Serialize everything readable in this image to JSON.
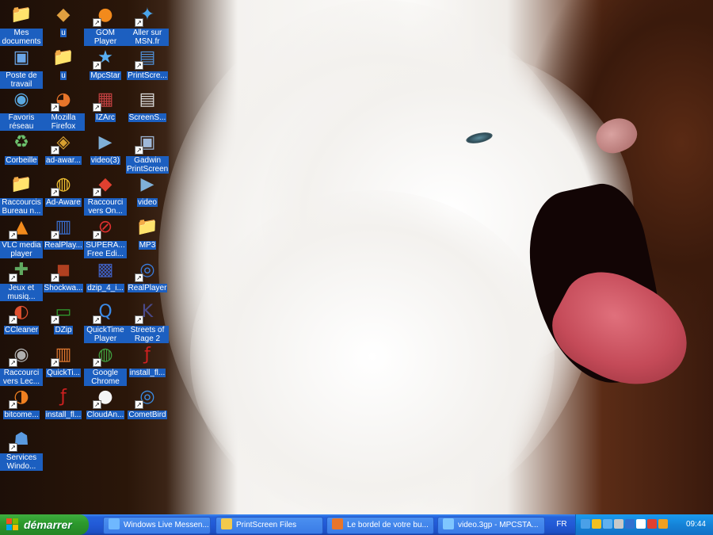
{
  "desktop_icons": [
    {
      "label": "Mes documents",
      "icon": "folder-documents-icon",
      "shortcut": false
    },
    {
      "label": "u",
      "icon": "app-icon",
      "shortcut": false
    },
    {
      "label": "GOM Player",
      "icon": "gom-player-icon",
      "shortcut": true
    },
    {
      "label": "Aller sur MSN.fr",
      "icon": "msn-icon",
      "shortcut": true
    },
    {
      "label": "Poste de travail",
      "icon": "computer-icon",
      "shortcut": false
    },
    {
      "label": "u",
      "icon": "folder-icon",
      "shortcut": false
    },
    {
      "label": "MpcStar",
      "icon": "mpcstar-icon",
      "shortcut": true
    },
    {
      "label": "PrintScre...",
      "icon": "printscreen-icon",
      "shortcut": true
    },
    {
      "label": "Favoris réseau",
      "icon": "network-icon",
      "shortcut": false
    },
    {
      "label": "Mozilla Firefox",
      "icon": "firefox-icon",
      "shortcut": true
    },
    {
      "label": "IZArc",
      "icon": "izarc-icon",
      "shortcut": true
    },
    {
      "label": "ScreenS...",
      "icon": "screenshot-file-icon",
      "shortcut": false
    },
    {
      "label": "Corbeille",
      "icon": "recycle-bin-icon",
      "shortcut": false
    },
    {
      "label": "ad-awar...",
      "icon": "adaware-icon",
      "shortcut": true
    },
    {
      "label": "video(3)",
      "icon": "video-file-icon",
      "shortcut": false
    },
    {
      "label": "Gadwin PrintScreen",
      "icon": "gadwin-icon",
      "shortcut": true
    },
    {
      "label": "Raccourcis Bureau n...",
      "icon": "folder-icon",
      "shortcut": false
    },
    {
      "label": "Ad-Aware",
      "icon": "adaware-globe-icon",
      "shortcut": true
    },
    {
      "label": "Raccourci vers On...",
      "icon": "shortcut-app-icon",
      "shortcut": true
    },
    {
      "label": "video",
      "icon": "video-file-icon",
      "shortcut": false
    },
    {
      "label": "VLC media player",
      "icon": "vlc-icon",
      "shortcut": true
    },
    {
      "label": "RealPlay...",
      "icon": "realplayer-box-icon",
      "shortcut": true
    },
    {
      "label": "SUPERA... Free Edi...",
      "icon": "supera-icon",
      "shortcut": true
    },
    {
      "label": "MP3",
      "icon": "folder-icon",
      "shortcut": false
    },
    {
      "label": "Jeux et musiq...",
      "icon": "games-icon",
      "shortcut": true
    },
    {
      "label": "Shockwa...",
      "icon": "shockwave-icon",
      "shortcut": true
    },
    {
      "label": "dzip_4_i...",
      "icon": "installer-icon",
      "shortcut": false
    },
    {
      "label": "RealPlayer",
      "icon": "realplayer-icon",
      "shortcut": true
    },
    {
      "label": "CCleaner",
      "icon": "ccleaner-icon",
      "shortcut": true
    },
    {
      "label": "DZip",
      "icon": "dzip-icon",
      "shortcut": true
    },
    {
      "label": "QuickTime Player",
      "icon": "quicktime-icon",
      "shortcut": true
    },
    {
      "label": "Streets of Rage 2",
      "icon": "game-k-icon",
      "shortcut": true
    },
    {
      "label": "Raccourci vers Lec...",
      "icon": "cd-drive-icon",
      "shortcut": true
    },
    {
      "label": "QuickTi...",
      "icon": "quicktime-box-icon",
      "shortcut": true
    },
    {
      "label": "Google Chrome",
      "icon": "chrome-icon",
      "shortcut": true
    },
    {
      "label": "install_fl...",
      "icon": "flash-icon",
      "shortcut": false
    },
    {
      "label": "bitcome...",
      "icon": "bitcomet-icon",
      "shortcut": true
    },
    {
      "label": "install_fl...",
      "icon": "flash-icon",
      "shortcut": false
    },
    {
      "label": "CloudAn...",
      "icon": "panda-icon",
      "shortcut": true
    },
    {
      "label": "CometBird",
      "icon": "cometbird-icon",
      "shortcut": true
    },
    {
      "label": "Services Windo...",
      "icon": "services-icon",
      "shortcut": true
    }
  ],
  "taskbar": {
    "start_label": "démarrer",
    "tasks": [
      {
        "label": "Windows Live Messen...",
        "icon": "messenger-icon",
        "color": "#6fb8ff"
      },
      {
        "label": "PrintScreen Files",
        "icon": "folder-icon",
        "color": "#f2c94c"
      },
      {
        "label": "Le bordel de votre bu...",
        "icon": "firefox-icon",
        "color": "#e8752a"
      },
      {
        "label": "video.3gp - MPCSTA...",
        "icon": "mpcstar-icon",
        "color": "#7fc6ff"
      }
    ],
    "language": "FR",
    "clock": "09:44",
    "tray_icons": [
      "shield-icon",
      "network-icon",
      "messenger-icon",
      "volume-icon",
      "bluetooth-icon",
      "panda-icon",
      "security-icon",
      "update-icon"
    ]
  },
  "colors": {
    "taskbar_blue": "#225ad6",
    "start_green": "#2d9a2d",
    "tray_blue": "#1583d8",
    "label_highlight": "#1c5fc0"
  }
}
